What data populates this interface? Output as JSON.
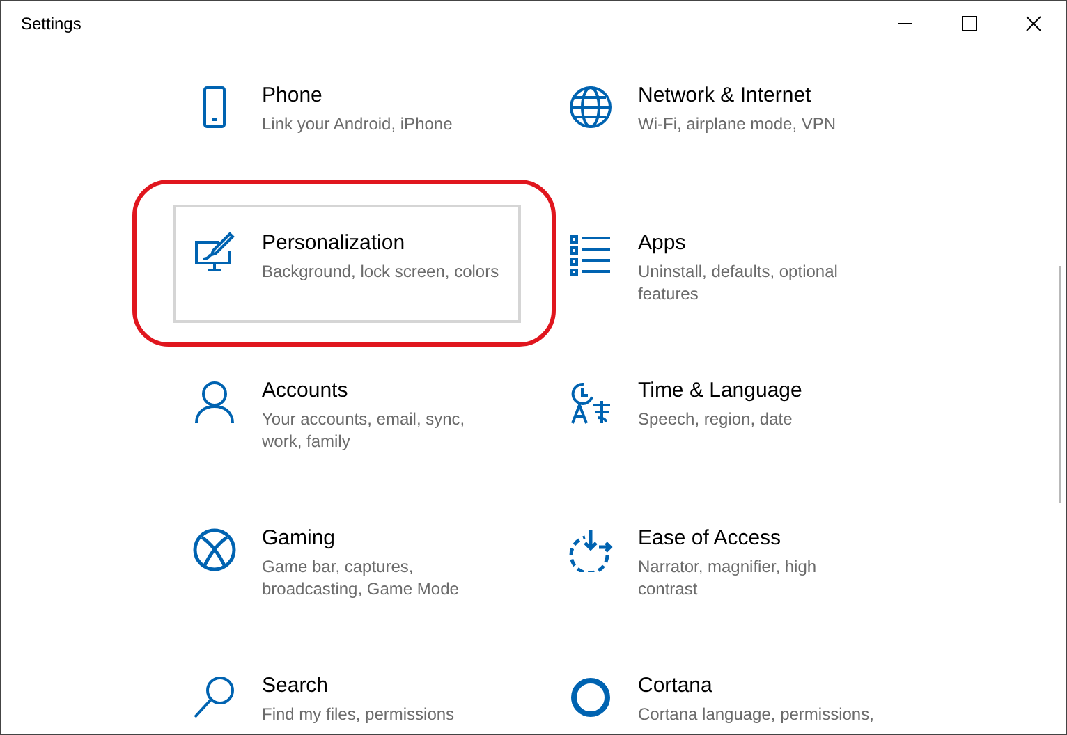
{
  "window": {
    "title": "Settings",
    "controls": [
      {
        "kind": "minimize"
      },
      {
        "kind": "maximize"
      },
      {
        "kind": "close"
      }
    ]
  },
  "categories": [
    {
      "title": "Phone",
      "description_lines": [
        "Link your Android, iPhone"
      ],
      "selected": false,
      "highlighted": false
    },
    {
      "title": "Network & Internet",
      "description_lines": [
        "Wi-Fi, airplane mode, VPN"
      ],
      "selected": false,
      "highlighted": false
    },
    {
      "title": "Personalization",
      "description_lines": [
        "Background, lock screen, colors"
      ],
      "selected": true,
      "highlighted": true
    },
    {
      "title": "Apps",
      "description_lines": [
        "Uninstall, defaults, optional",
        "features"
      ],
      "selected": false,
      "highlighted": false
    },
    {
      "title": "Accounts",
      "description_lines": [
        "Your accounts, email, sync,",
        "work, family"
      ],
      "selected": false,
      "highlighted": false
    },
    {
      "title": "Time & Language",
      "description_lines": [
        "Speech, region, date"
      ],
      "selected": false,
      "highlighted": false
    },
    {
      "title": "Gaming",
      "description_lines": [
        "Game bar, captures,",
        "broadcasting, Game Mode"
      ],
      "selected": false,
      "highlighted": false
    },
    {
      "title": "Ease of Access",
      "description_lines": [
        "Narrator, magnifier, high",
        "contrast"
      ],
      "selected": false,
      "highlighted": false
    },
    {
      "title": "Search",
      "description_lines": [
        "Find my files, permissions"
      ],
      "selected": false,
      "highlighted": false
    },
    {
      "title": "Cortana",
      "description_lines": [
        "Cortana language, permissions,"
      ],
      "selected": false,
      "highlighted": false
    }
  ]
}
